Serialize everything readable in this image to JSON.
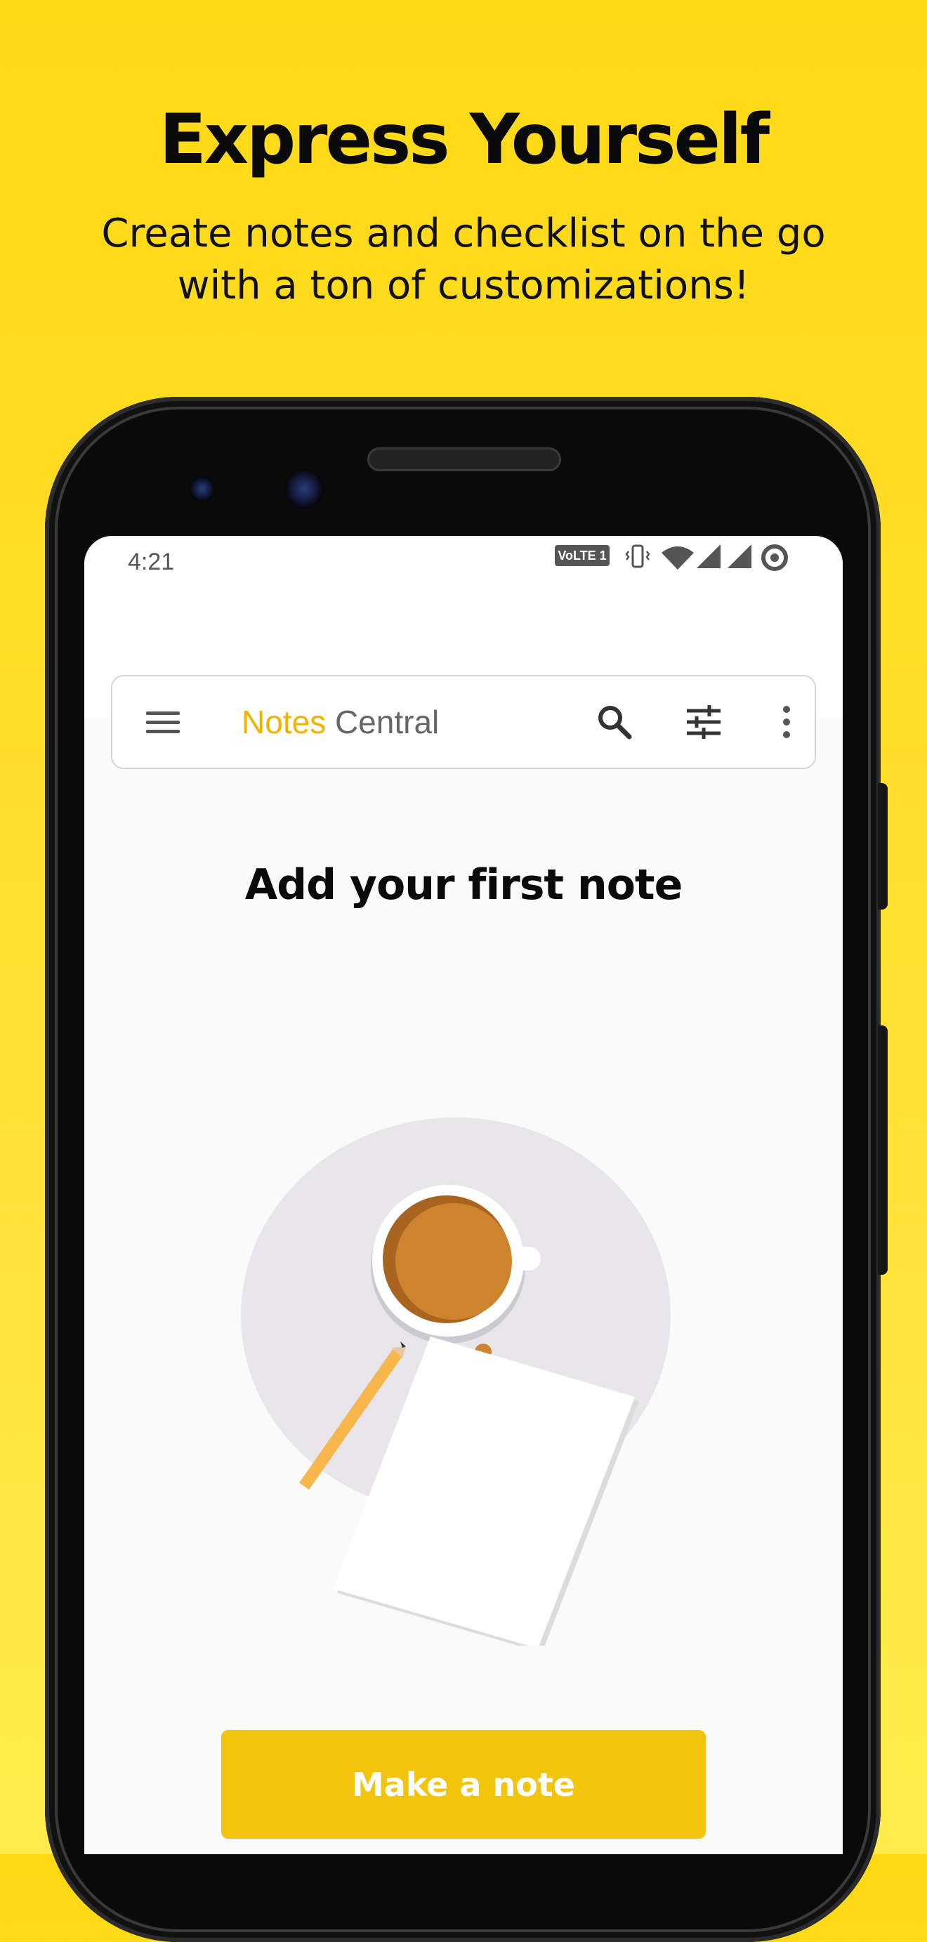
{
  "promo": {
    "title": "Express Yourself",
    "subtitle_line1": "Create notes and checklist on the go",
    "subtitle_line2": "with a ton of customizations!"
  },
  "status_bar": {
    "time": "4:21",
    "volte": "VoLTE 1",
    "icons": [
      "volte-icon",
      "vibrate-icon",
      "wifi-icon",
      "signal-icon",
      "signal-icon",
      "data-saver-icon"
    ]
  },
  "toolbar": {
    "title_accent": "Notes",
    "title_rest": "Central",
    "icons": [
      "menu-icon",
      "search-icon",
      "filter-icon",
      "more-vert-icon"
    ]
  },
  "empty_state": {
    "heading": "Add your first note",
    "illustration": "coffee-cup-notepad-pencil"
  },
  "actions": {
    "make_note_label": "Make a note"
  },
  "colors": {
    "background": "#FFD914",
    "accent": "#F2C40E",
    "title_accent": "#F0B400",
    "coffee": "#CE842C"
  }
}
